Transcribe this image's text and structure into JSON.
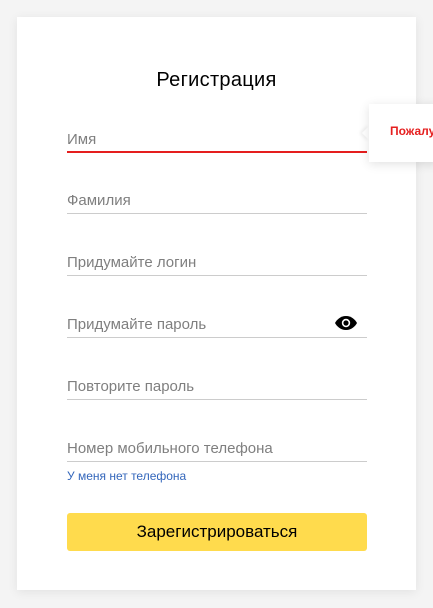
{
  "form": {
    "title": "Регистрация",
    "fields": {
      "first_name": {
        "placeholder": "Имя",
        "value": ""
      },
      "last_name": {
        "placeholder": "Фамилия",
        "value": ""
      },
      "login": {
        "placeholder": "Придумайте логин",
        "value": ""
      },
      "password": {
        "placeholder": "Придумайте пароль",
        "value": ""
      },
      "password_repeat": {
        "placeholder": "Повторите пароль",
        "value": ""
      },
      "phone": {
        "placeholder": "Номер мобильного телефона",
        "value": ""
      }
    },
    "no_phone_link": "У меня нет телефона",
    "submit_label": "Зарегистрироваться"
  },
  "tooltip": {
    "text": "Пожалу"
  },
  "icons": {
    "password_toggle": "eye-icon"
  },
  "colors": {
    "error": "#e51e1e",
    "link": "#3366bb",
    "submit_bg": "#ffdb4d"
  }
}
